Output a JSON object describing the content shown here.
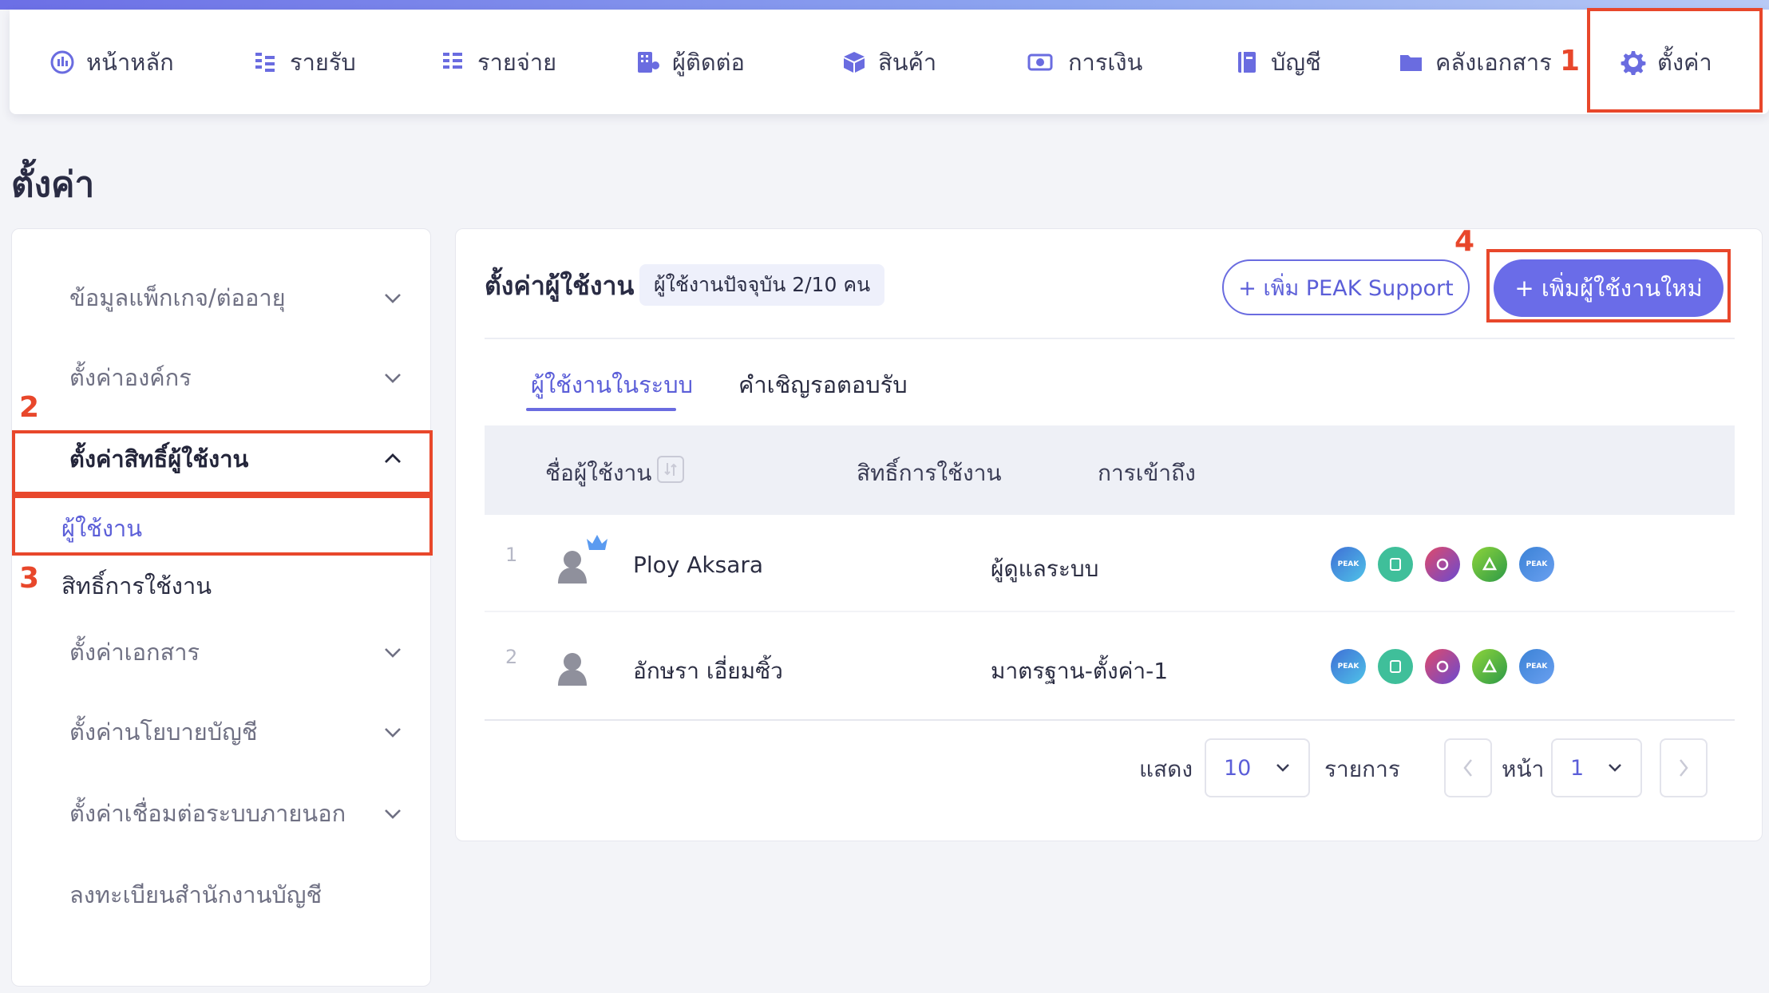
{
  "nav": {
    "items": [
      {
        "label": "หน้าหลัก",
        "icon": "dashboard-icon"
      },
      {
        "label": "รายรับ",
        "icon": "income-icon"
      },
      {
        "label": "รายจ่าย",
        "icon": "expense-icon"
      },
      {
        "label": "ผู้ติดต่อ",
        "icon": "contacts-icon"
      },
      {
        "label": "สินค้า",
        "icon": "product-box-icon"
      },
      {
        "label": "การเงิน",
        "icon": "money-icon"
      },
      {
        "label": "บัญชี",
        "icon": "ledger-book-icon"
      },
      {
        "label": "คลังเอกสาร",
        "icon": "folder-icon"
      },
      {
        "label": "ตั้งค่า",
        "icon": "gear-icon"
      }
    ]
  },
  "annotations": [
    "1",
    "2",
    "3",
    "4"
  ],
  "page_title": "ตั้งค่า",
  "sidebar": {
    "items": [
      {
        "label": "ข้อมูลแพ็กเกจ/ต่ออายุ"
      },
      {
        "label": "ตั้งค่าองค์กร"
      },
      {
        "label": "ตั้งค่าสิทธิ์ผู้ใช้งาน"
      },
      {
        "label": "ตั้งค่าเอกสาร"
      },
      {
        "label": "ตั้งค่านโยบายบัญชี"
      },
      {
        "label": "ตั้งค่าเชื่อมต่อระบบภายนอก"
      },
      {
        "label": "ลงทะเบียนสำนักงานบัญชี"
      }
    ],
    "sub_items": [
      {
        "label": "ผู้ใช้งาน"
      },
      {
        "label": "สิทธิ์การใช้งาน"
      }
    ]
  },
  "main": {
    "title": "ตั้งค่าผู้ใช้งาน",
    "count_badge": "ผู้ใช้งานปัจจุบัน 2/10 คน",
    "btn_peak_support": "+ เพิ่ม PEAK Support",
    "btn_add_user": "+ เพิ่มผู้ใช้งานใหม่",
    "tabs": [
      {
        "label": "ผู้ใช้งานในระบบ"
      },
      {
        "label": "คำเชิญรอตอบรับ"
      }
    ],
    "columns": {
      "name": "ชื่อผู้ใช้งาน",
      "role": "สิทธิ์การใช้งาน",
      "access": "การเข้าถึง"
    },
    "rows": [
      {
        "num": "1",
        "name": "Ploy Aksara",
        "role": "ผู้ดูแลระบบ",
        "owner_crown": true
      },
      {
        "num": "2",
        "name": "อักษรา เอี่ยมซิ้ว",
        "role": "มาตรฐาน-ตั้งค่า-1",
        "owner_crown": false
      }
    ],
    "access_apps": [
      {
        "label": "PEAK",
        "color": "#3f6fd6"
      },
      {
        "label": "",
        "color": "#3fbf9a"
      },
      {
        "label": "",
        "color": "#b04a9a"
      },
      {
        "label": "",
        "color": "#4aa83e"
      },
      {
        "label": "PEAK",
        "color": "#3b82d6"
      }
    ],
    "pager": {
      "show_label": "แสดง",
      "page_size": "10",
      "items_label": "รายการ",
      "page_label": "หน้า",
      "page": "1"
    }
  }
}
